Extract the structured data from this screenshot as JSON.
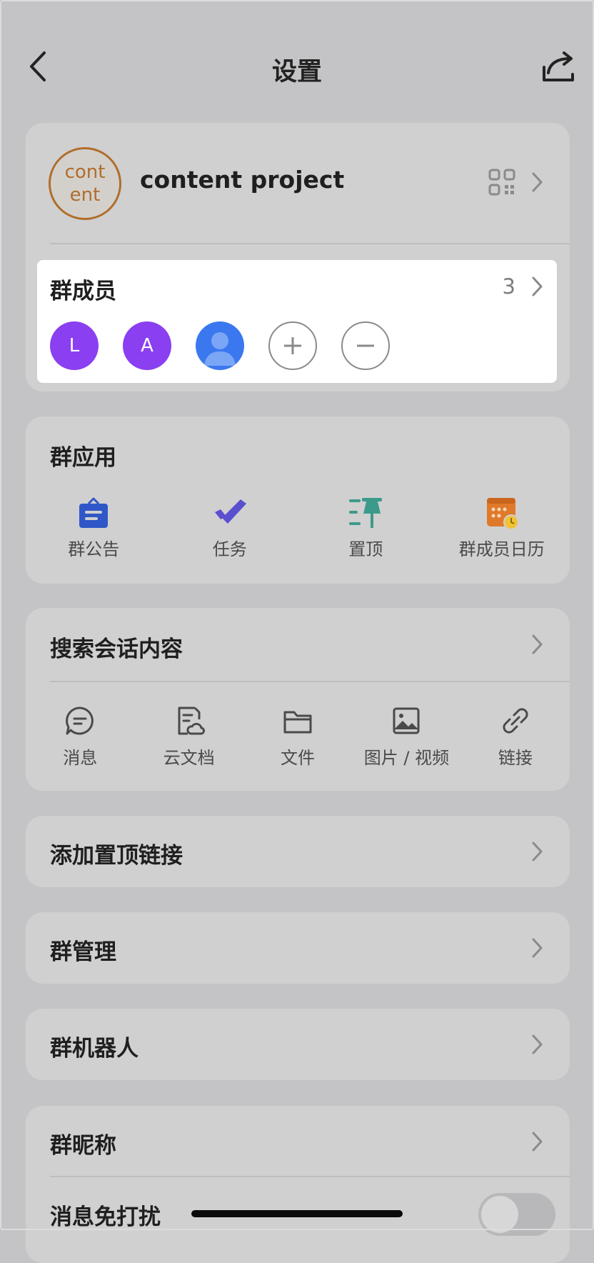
{
  "header": {
    "title": "设置"
  },
  "group": {
    "avatar_line1": "cont",
    "avatar_line2": "ent",
    "name": "content project"
  },
  "members": {
    "label": "群成员",
    "count": "3",
    "avatars": [
      {
        "initial": "L",
        "color": "#8a3ff0"
      },
      {
        "initial": "A",
        "color": "#8a3ff0"
      },
      {
        "initial": "",
        "color": "#3b78f0"
      }
    ]
  },
  "apps": {
    "title": "群应用",
    "items": [
      {
        "label": "群公告",
        "icon": "announcement-icon"
      },
      {
        "label": "任务",
        "icon": "task-check-icon"
      },
      {
        "label": "置顶",
        "icon": "pin-icon"
      },
      {
        "label": "群成员日历",
        "icon": "calendar-icon"
      }
    ]
  },
  "search": {
    "title": "搜索会话内容",
    "items": [
      {
        "label": "消息",
        "icon": "message-icon"
      },
      {
        "label": "云文档",
        "icon": "cloud-doc-icon"
      },
      {
        "label": "文件",
        "icon": "folder-icon"
      },
      {
        "label": "图片 / 视频",
        "icon": "image-icon"
      },
      {
        "label": "链接",
        "icon": "link-icon"
      }
    ]
  },
  "rows": {
    "pin_link": "添加置顶链接",
    "manage": "群管理",
    "bots": "群机器人",
    "nickname": "群昵称",
    "mute": "消息免打扰"
  },
  "mute_enabled": false,
  "colors": {
    "background": "#c4c4c6",
    "card": "#d0d0d1",
    "member_panel": "#ffffff",
    "avatar_border": "#b06e2a",
    "announcement": "#2f57c8",
    "task": "#5a4fcf",
    "pin": "#3c9a8b",
    "calendar": "#e07a2a"
  }
}
